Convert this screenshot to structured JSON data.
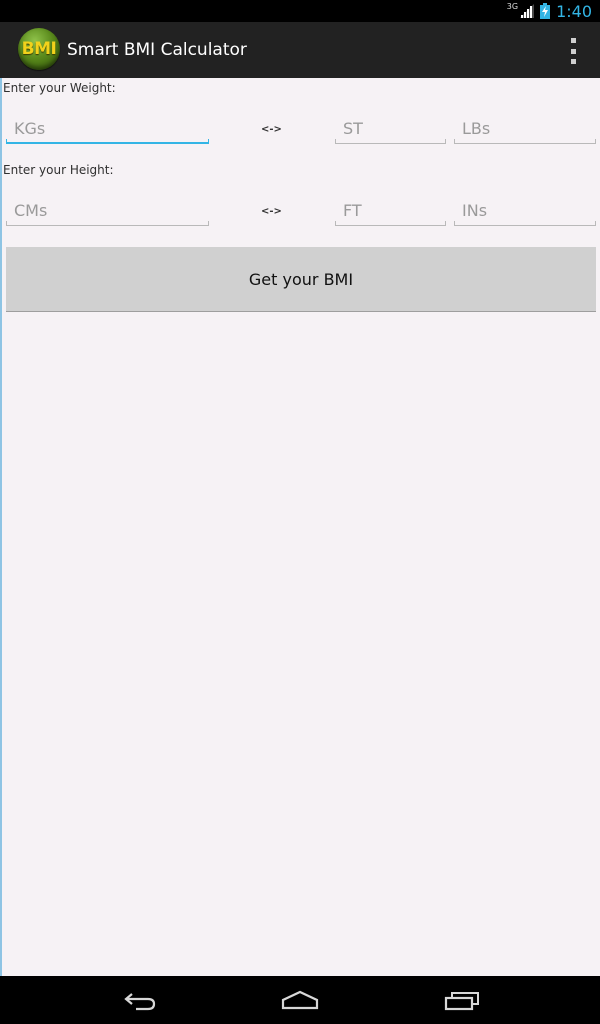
{
  "status_bar": {
    "network": "3G",
    "time": "1:40",
    "signal_icon": "signal-icon",
    "battery_icon": "battery-charging-icon"
  },
  "action_bar": {
    "app_icon_text": "BMI",
    "title": "Smart BMI Calculator",
    "overflow_icon": "overflow-menu-icon"
  },
  "weight": {
    "label": "Enter your Weight:",
    "kg_placeholder": "KGs",
    "kg_value": "",
    "separator": "<->",
    "st_placeholder": "ST",
    "st_value": "",
    "lb_placeholder": "LBs",
    "lb_value": ""
  },
  "height": {
    "label": "Enter your Height:",
    "cm_placeholder": "CMs",
    "cm_value": "",
    "separator": "<->",
    "ft_placeholder": "FT",
    "ft_value": "",
    "in_placeholder": "INs",
    "in_value": ""
  },
  "action": {
    "button_label": "Get your BMI"
  },
  "nav_bar": {
    "back_icon": "back-icon",
    "home_icon": "home-icon",
    "recents_icon": "recents-icon"
  },
  "colors": {
    "accent": "#33b5e5",
    "action_bar_bg": "#222222",
    "content_bg": "#f6f2f5",
    "button_bg": "#d0d0d0",
    "icon_text": "#f2d21b",
    "icon_green": "#5a8a1c"
  }
}
